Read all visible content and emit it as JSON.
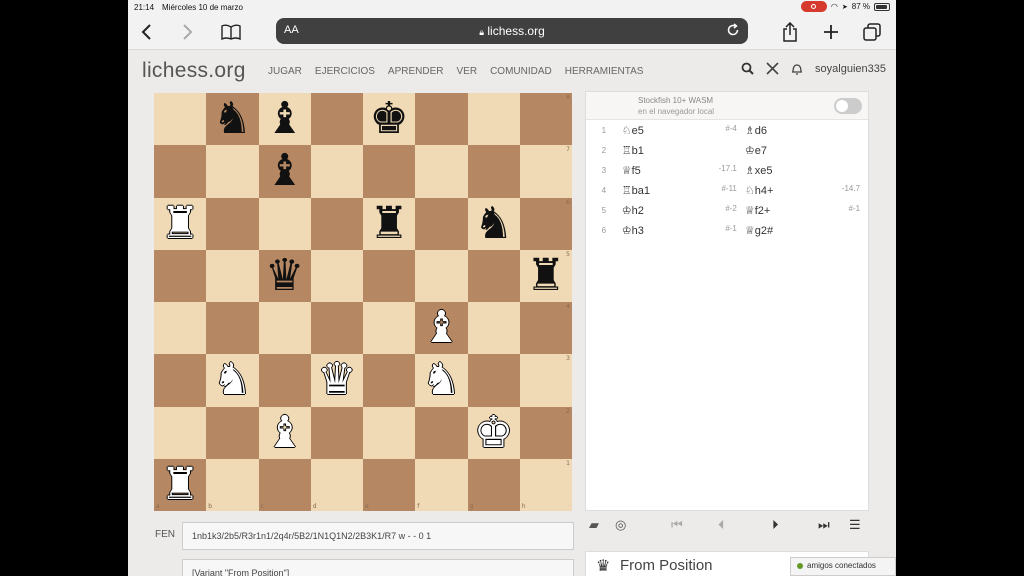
{
  "status": {
    "time": "21:14",
    "date": "Miércoles 10 de marzo",
    "battery": "87 %"
  },
  "browser": {
    "aa": "AA",
    "url": "lichess.org"
  },
  "header": {
    "logo": "lichess.org",
    "nav": [
      "JUGAR",
      "EJERCICIOS",
      "APRENDER",
      "VER",
      "COMUNIDAD",
      "HERRAMIENTAS"
    ],
    "username": "soyalguien335"
  },
  "board": {
    "ranks": [
      [
        "",
        "bN",
        "bB",
        "",
        "bK",
        "",
        "",
        ""
      ],
      [
        "",
        "",
        "bB",
        "",
        "",
        "",
        "",
        ""
      ],
      [
        "wR",
        "",
        "",
        "",
        "bR",
        "",
        "bN",
        ""
      ],
      [
        "",
        "",
        "bQ",
        "",
        "",
        "",
        "",
        "bR"
      ],
      [
        "",
        "",
        "",
        "",
        "",
        "wB",
        "",
        ""
      ],
      [
        "",
        "wN",
        "",
        "wQ",
        "",
        "wN",
        "",
        ""
      ],
      [
        "",
        "",
        "wB",
        "",
        "",
        "",
        "wK",
        ""
      ],
      [
        "wR",
        "",
        "",
        "",
        "",
        "",
        "",
        ""
      ]
    ],
    "rank_labels": [
      "8",
      "7",
      "6",
      "5",
      "4",
      "3",
      "2",
      "1"
    ],
    "file_labels": [
      "a",
      "b",
      "c",
      "d",
      "e",
      "f",
      "g",
      "h"
    ]
  },
  "ceval": {
    "line1": "Stockfish 10+ WASM",
    "line2": "en el navegador local"
  },
  "moves": [
    {
      "n": "1",
      "w": "♘e5",
      "we": "#-4",
      "b": "♗d6",
      "be": ""
    },
    {
      "n": "2",
      "w": "♖b1",
      "we": "",
      "b": "♔e7",
      "be": ""
    },
    {
      "n": "3",
      "w": "♕f5",
      "we": "-17.1",
      "b": "♗xe5",
      "be": ""
    },
    {
      "n": "4",
      "w": "♖ba1",
      "we": "#-11",
      "b": "♘h4+",
      "be": "-14.7"
    },
    {
      "n": "5",
      "w": "♔h2",
      "we": "#-2",
      "b": "♕f2+",
      "be": "#-1"
    },
    {
      "n": "6",
      "w": "♔h3",
      "we": "#-1",
      "b": "♕g2#",
      "be": ""
    }
  ],
  "fen": {
    "label": "FEN",
    "value": "1nb1k3/2b5/R3r1n1/2q4r/5B2/1N1Q1N2/2B3K1/R7 w - - 0 1"
  },
  "pgn": {
    "value": "[Variant \"From Position\"]"
  },
  "study": {
    "title": "From Position"
  },
  "friends": {
    "label": "amigos conectados"
  }
}
